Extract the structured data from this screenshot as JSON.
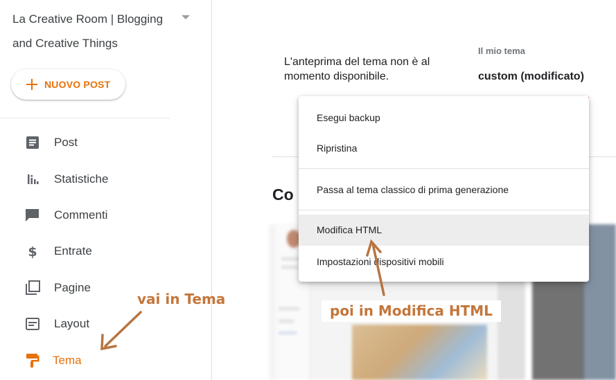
{
  "sidebar": {
    "blog_title": "La Creative Room | Blogging and Creative Things",
    "new_post_label": "NUOVO POST",
    "items": [
      {
        "label": "Post",
        "icon": "post-icon"
      },
      {
        "label": "Statistiche",
        "icon": "stats-icon"
      },
      {
        "label": "Commenti",
        "icon": "comments-icon"
      },
      {
        "label": "Entrate",
        "icon": "dollar-icon"
      },
      {
        "label": "Pagine",
        "icon": "pages-icon"
      },
      {
        "label": "Layout",
        "icon": "layout-icon"
      },
      {
        "label": "Tema",
        "icon": "paint-roller-icon",
        "active": true
      }
    ]
  },
  "main": {
    "preview_message": "L'anteprima del tema non è al momento disponibile.",
    "my_theme_caption": "Il mio tema",
    "theme_name": "custom (modificato)",
    "section_heading": "Co"
  },
  "menu": {
    "items": [
      {
        "label": "Esegui backup"
      },
      {
        "label": "Ripristina"
      },
      {
        "label": "Passa al tema classico di prima generazione"
      },
      {
        "label": "Modifica HTML",
        "highlighted": true
      },
      {
        "label": "Impostazioni dispositivi mobili"
      }
    ]
  },
  "annotations": {
    "first": "vai in Tema",
    "second": "poi in Modifica HTML"
  },
  "colors": {
    "accent": "#e8710a",
    "annotation": "#c4763a",
    "icon_gray": "#5f6368"
  }
}
